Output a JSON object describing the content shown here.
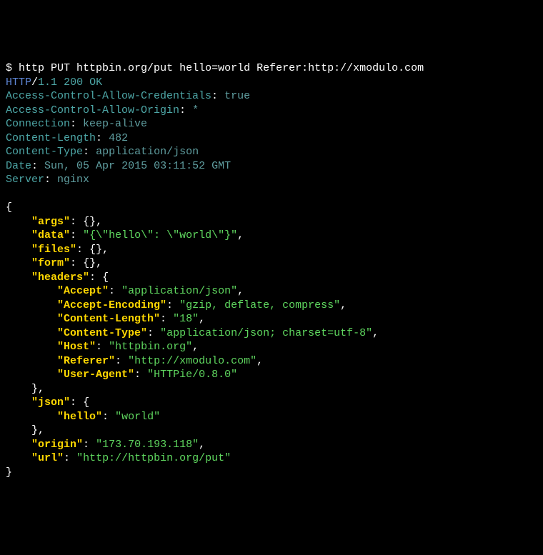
{
  "command": {
    "prompt": "$",
    "text": "http PUT httpbin.org/put hello=world Referer:http://xmodulo.com"
  },
  "status": {
    "protocol": "HTTP",
    "version": "1.1",
    "code": "200 OK"
  },
  "headers": {
    "Access-Control-Allow-Credentials": "true",
    "Access-Control-Allow-Origin": "*",
    "Connection": "keep-alive",
    "Content-Length": "482",
    "Content-Type": "application/json",
    "Date": "Sun, 05 Apr 2015 03:11:52 GMT",
    "Server": "nginx"
  },
  "body": {
    "args": "{}",
    "data": "\"{\\\"hello\\\": \\\"world\\\"}\"",
    "files": "{}",
    "form": "{}",
    "headers": {
      "Accept": "\"application/json\"",
      "Accept-Encoding": "\"gzip, deflate, compress\"",
      "Content-Length": "\"18\"",
      "Content-Type": "\"application/json; charset=utf-8\"",
      "Host": "\"httpbin.org\"",
      "Referer": "\"http://xmodulo.com\"",
      "User-Agent": "\"HTTPie/0.8.0\""
    },
    "json": {
      "hello": "\"world\""
    },
    "origin": "\"173.70.193.118\"",
    "url": "\"http://httpbin.org/put\""
  },
  "labels": {
    "args": "\"args\"",
    "data": "\"data\"",
    "files": "\"files\"",
    "form": "\"form\"",
    "headers": "\"headers\"",
    "Accept": "\"Accept\"",
    "AcceptEncoding": "\"Accept-Encoding\"",
    "ContentLength": "\"Content-Length\"",
    "ContentType": "\"Content-Type\"",
    "Host": "\"Host\"",
    "Referer": "\"Referer\"",
    "UserAgent": "\"User-Agent\"",
    "json": "\"json\"",
    "hello": "\"hello\"",
    "origin": "\"origin\"",
    "url": "\"url\""
  },
  "hdrLabels": {
    "acac": "Access-Control-Allow-Credentials",
    "acao": "Access-Control-Allow-Origin",
    "conn": "Connection",
    "clen": "Content-Length",
    "ctype": "Content-Type",
    "date": "Date",
    "server": "Server"
  }
}
